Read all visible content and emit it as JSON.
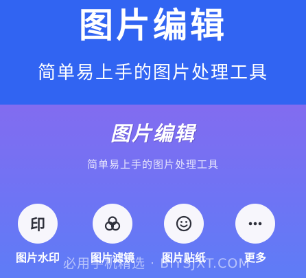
{
  "banner": {
    "title": "图片编辑",
    "subtitle": "简单易上手的图片处理工具"
  },
  "app": {
    "title": "图片编辑",
    "subtitle": "简单易上手的图片处理工具"
  },
  "tools": [
    {
      "label": "图片水印",
      "icon": "stamp-icon",
      "glyph": "印"
    },
    {
      "label": "图片滤镜",
      "icon": "filter-icon"
    },
    {
      "label": "图片贴纸",
      "icon": "smiley-icon"
    },
    {
      "label": "更多",
      "icon": "more-dots-icon"
    }
  ],
  "watermark": "必用手机精选 · BIYSJXT.COM",
  "colors": {
    "banner_bg": "#3164f2",
    "app_gradient_top": "#826cf0",
    "app_gradient_bottom": "#5e7cf6",
    "tool_circle": "#f7f6fc",
    "icon": "#2d2f3a"
  }
}
